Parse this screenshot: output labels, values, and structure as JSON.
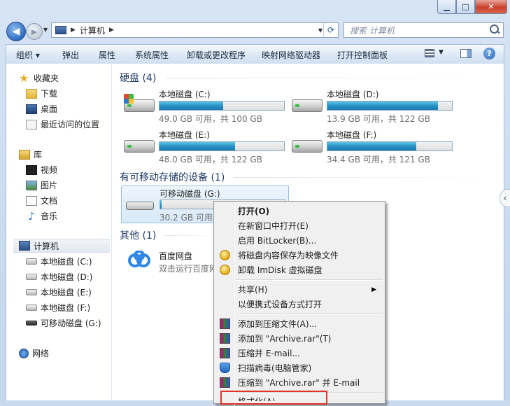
{
  "window": {
    "min_glyph": "▁",
    "max_glyph": "□",
    "close_glyph": "✕"
  },
  "address": {
    "back_glyph": "◀",
    "fwd_glyph": "▶",
    "path": "计算机",
    "sep": "▶",
    "refresh_glyph": "⟳",
    "search_placeholder": "搜索 计算机"
  },
  "toolbar": {
    "organize": "组织 ▾",
    "eject": "弹出",
    "properties": "属性",
    "system_properties": "系统属性",
    "uninstall": "卸载或更改程序",
    "map_drive": "映射网络驱动器",
    "control_panel": "打开控制面板",
    "help_glyph": "?"
  },
  "sidebar": {
    "favorites": "收藏夹",
    "downloads": "下载",
    "desktop": "桌面",
    "recent": "最近访问的位置",
    "libraries": "库",
    "videos": "视频",
    "pictures": "图片",
    "documents": "文档",
    "music": "音乐",
    "computer": "计算机",
    "drive_c": "本地磁盘 (C:)",
    "drive_d": "本地磁盘 (D:)",
    "drive_e": "本地磁盘 (E:)",
    "drive_f": "本地磁盘 (F:)",
    "drive_g": "可移动磁盘 (G:)",
    "network": "网络"
  },
  "main": {
    "hard_disks_header": "硬盘 (4)",
    "removable_header": "有可移动存储的设备 (1)",
    "other_header": "其他 (1)",
    "drives": [
      {
        "name": "本地磁盘 (C:)",
        "free": "49.0 GB 可用，共 100 GB",
        "used_fraction": 0.51
      },
      {
        "name": "本地磁盘 (D:)",
        "free": "13.9 GB 可用，共 122 GB",
        "used_fraction": 0.886
      },
      {
        "name": "本地磁盘 (E:)",
        "free": "48.0 GB 可用，共 122 GB",
        "used_fraction": 0.607
      },
      {
        "name": "本地磁盘 (F:)",
        "free": "34.4 GB 可用，共 121 GB",
        "used_fraction": 0.716
      }
    ],
    "removable": {
      "name": "可移动磁盘 (G:)",
      "free": "30.2 GB 可用，共",
      "used_fraction": 0.01
    },
    "baidu": {
      "name": "百度网盘",
      "sub": "双击运行百度网"
    }
  },
  "context_menu": {
    "open": "打开(O)",
    "open_new_window": "在新窗口中打开(E)",
    "bitlocker": "启用 BitLocker(B)...",
    "save_image": "将磁盘内容保存为映像文件",
    "unmount_imdisk": "卸载 ImDisk 虚拟磁盘",
    "share": "共享(H)",
    "portable_open": "以便携式设备方式打开",
    "add_archive": "添加到压缩文件(A)...",
    "add_archive_rar": "添加到 \"Archive.rar\"(T)",
    "compress_email": "压缩并 E-mail...",
    "scan_virus": "扫描病毒(电脑管家)",
    "compress_rar_email": "压缩到 \"Archive.rar\" 并 E-mail",
    "format_partial": "格式化(A)...",
    "submenu_glyph": "▶"
  },
  "colors": {
    "accent_bar": "#2791c4",
    "highlight_box": "#e2352a"
  }
}
